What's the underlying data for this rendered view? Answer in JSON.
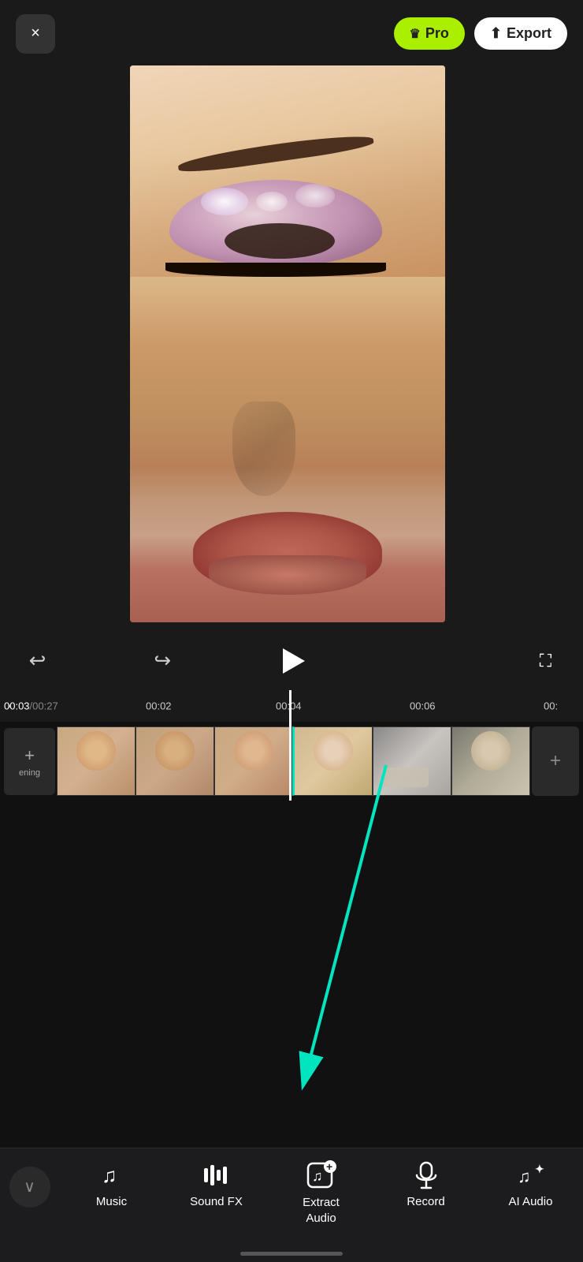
{
  "header": {
    "close_label": "×",
    "pro_label": "Pro",
    "pro_icon": "👑",
    "export_label": "Export",
    "export_icon": "↑"
  },
  "controls": {
    "undo_icon": "↩",
    "redo_icon": "↪",
    "play_label": "Play",
    "fullscreen_icon": "⛶"
  },
  "timeline": {
    "current_time": "00:03",
    "total_time": "00:27",
    "markers": [
      "00:02",
      "00:04",
      "00:06",
      "00:"
    ]
  },
  "bottom_nav": {
    "collapse_icon": "∨",
    "items": [
      {
        "id": "music",
        "label": "Music",
        "icon": "♫"
      },
      {
        "id": "sound-fx",
        "label": "Sound FX",
        "icon": "▌▌▌"
      },
      {
        "id": "extract-audio",
        "label": "Extract\nAudio",
        "icon": "🎵+"
      },
      {
        "id": "record",
        "label": "Record",
        "icon": "🎤"
      },
      {
        "id": "ai-audio",
        "label": "AI Audio",
        "icon": "♫✦"
      }
    ]
  },
  "filmstrip": {
    "add_label": "+ ening",
    "add_icon": "+"
  }
}
